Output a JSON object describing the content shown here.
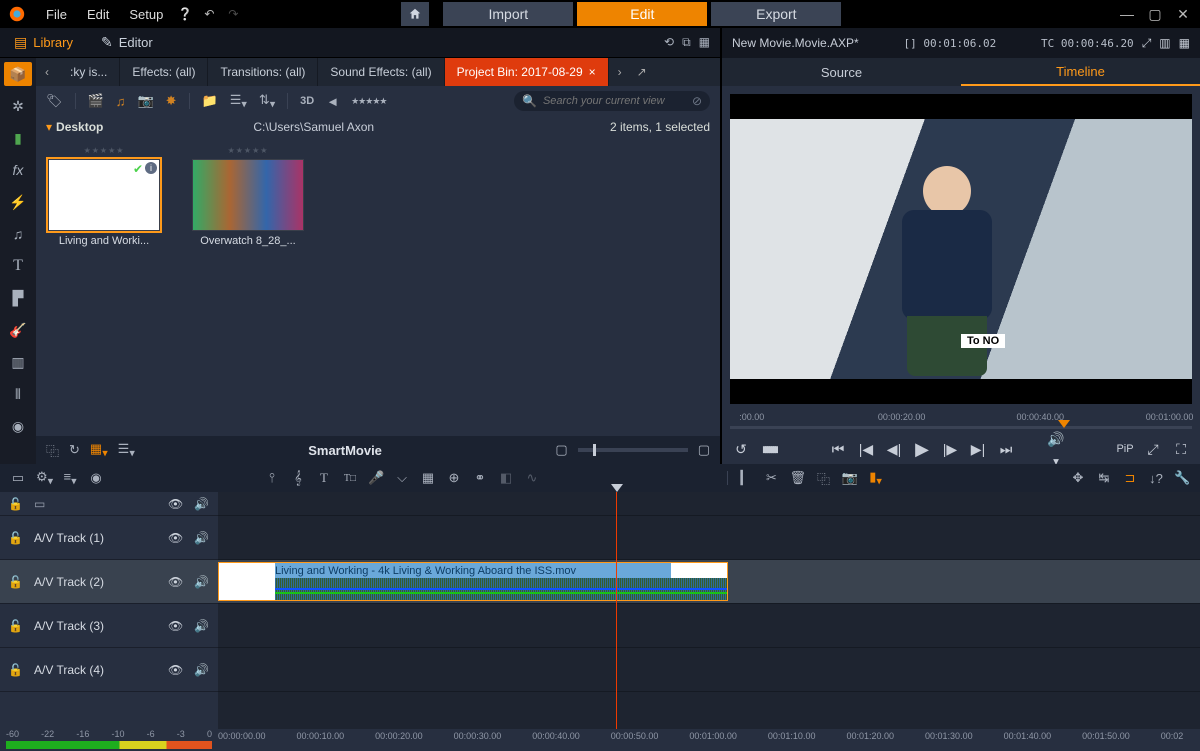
{
  "menu": {
    "file": "File",
    "edit": "Edit",
    "setup": "Setup"
  },
  "mainTabs": {
    "import": "Import",
    "edit": "Edit",
    "export": "Export"
  },
  "panelTabs": {
    "library": "Library",
    "editor": "Editor"
  },
  "categoryTabs": [
    {
      "label": ":ky is..."
    },
    {
      "label": "Effects: (all)"
    },
    {
      "label": "Transitions: (all)"
    },
    {
      "label": "Sound Effects: (all)"
    },
    {
      "label": "Project Bin: 2017-08-29",
      "active": true,
      "closable": true
    }
  ],
  "search": {
    "placeholder": "Search your current view"
  },
  "path": {
    "name": "Desktop",
    "full": "C:\\Users\\Samuel Axon",
    "count": "2 items, 1 selected"
  },
  "thumbs": [
    {
      "name": "Living and Worki...",
      "selected": true,
      "kind": "white"
    },
    {
      "name": "Overwatch 8_28_...",
      "selected": false,
      "kind": "game"
    }
  ],
  "libFoot": {
    "center": "SmartMovie"
  },
  "preview": {
    "project": "New Movie.Movie.AXP*",
    "tc1": "[]  00:01:06.02",
    "tc2": "TC  00:00:46.20",
    "tabs": {
      "source": "Source",
      "timeline": "Timeline"
    },
    "toNo": "To NO",
    "rulerTicks": [
      ":00.00",
      "00:00:20.00",
      "00:00:40.00",
      "00:01:00.00"
    ],
    "pip": "PiP",
    "playPct": 71
  },
  "tracks": [
    {
      "name": "",
      "thin": true
    },
    {
      "name": "A/V Track (1)"
    },
    {
      "name": "A/V Track (2)",
      "active": true,
      "clip": {
        "title": "Living and Working - 4k Living & Working Aboard the ISS.mov"
      }
    },
    {
      "name": "A/V Track (3)"
    },
    {
      "name": "A/V Track (4)"
    }
  ],
  "tlruler": {
    "meters": [
      "-60",
      "-22",
      "-16",
      "-10",
      "-6",
      "-3",
      "0"
    ],
    "ticks": [
      "00:00:00.00",
      "00:00:10.00",
      "00:00:20.00",
      "00:00:30.00",
      "00:00:40.00",
      "00:00:50.00",
      "00:01:00.00",
      "00:01:10.00",
      "00:01:20.00",
      "00:01:30.00",
      "00:01:40.00",
      "00:01:50.00",
      "00:02"
    ]
  },
  "playheadPct": 40.5
}
